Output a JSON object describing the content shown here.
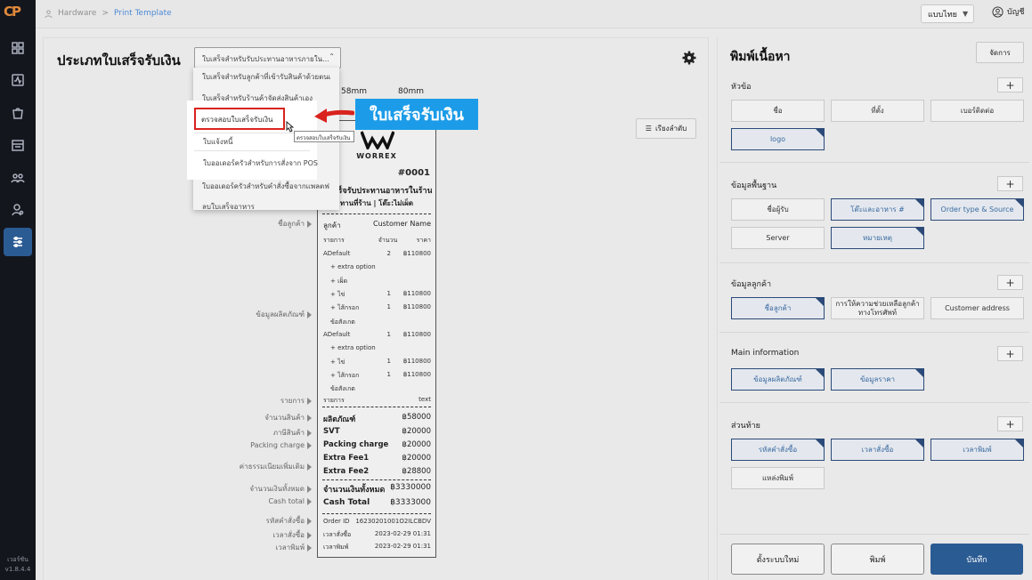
{
  "app": {
    "logo": "CP",
    "version_label": "เวอร์ชัน",
    "version": "v1.8.4.4"
  },
  "breadcrumb": {
    "root": "Hardware",
    "separator": ">",
    "current": "Print Template"
  },
  "topbar": {
    "language": "แบบไทย",
    "account": "บัญชี"
  },
  "center": {
    "title": "ประเภทใบเสร็จรับเงิน",
    "type_select_value": "ใบเสร็จสำหรับรับประทานอาหารภายใน...",
    "sort_button": "เรียงลำดับ",
    "width_options": [
      "58mm",
      "80mm"
    ],
    "dropdown_items": [
      "ใบเสร็จสำหรับลูกค้าที่เข้ารับสินค้าด้วยตนเ",
      "ใบเสร็จสำหรับร้านค้าจัดส่งสินค้าเอง",
      "ตรวจสอบใบเสร็จรับเงิน",
      "ใบแจ้งหนี้",
      "ใบออเดอร์ครัวสำหรับการสั่งจาก POS",
      "ใบออเดอร์ครัวสำหรับคำสั่งซื้อจากแพลตฟ",
      "ลบใบเสร็จอาหาร"
    ],
    "tooltip": "ตรวจสอบใบเสร็จรับเงิน",
    "callout": "ใบเสร็จรับเงิน"
  },
  "side_labels": [
    "ชื่อลูกค้า",
    "ข้อมูลผลิตภัณฑ์",
    "รายการ",
    "จำนวนสินค้า",
    "ภาษีสินค้า",
    "Packing charge",
    "ค่าธรรมเนียมเพิ่มเติม",
    "จำนวนเงินทั้งหมด",
    "Cash total",
    "รหัสคำสั่งซื้อ",
    "เวลาสั่งซื้อ",
    "เวลาพิมพ์"
  ],
  "receipt": {
    "brand": "WORREX",
    "order_no": "#0001",
    "heading": "ใบเสร็จรับประทานอาหารในร้าน",
    "subheading": "ทานที่ร้าน | โต๊ะ:ไม่เผ็ด",
    "customer_label": "ลูกค้า",
    "customer_value": "Customer Name",
    "col_item": "รายการ",
    "col_qty": "จำนวน",
    "col_price": "ราคา",
    "lines": [
      [
        "ADefault",
        "2",
        "฿110800"
      ],
      [
        "+ extra option",
        "",
        ""
      ],
      [
        "+ เผ็ด",
        "",
        ""
      ],
      [
        "+ ไข่",
        "1",
        "฿110800"
      ],
      [
        "+ ไส้กรอก",
        "1",
        "฿110800"
      ],
      [
        "ข้อสังเกต",
        "",
        ""
      ],
      [
        "ADefault",
        "1",
        "฿110800"
      ],
      [
        "+ extra option",
        "",
        ""
      ],
      [
        "+ ไข่",
        "1",
        "฿110800"
      ],
      [
        "+ ไส้กรอก",
        "1",
        "฿110800"
      ],
      [
        "ข้อสังเกต",
        "",
        ""
      ]
    ],
    "items_label": "รายการ",
    "items_value": "text",
    "totals": [
      [
        "ผลิตภัณฑ์",
        "฿58000"
      ],
      [
        "SVT",
        "฿20000"
      ],
      [
        "Packing charge",
        "฿20000"
      ],
      [
        "Extra Fee1",
        "฿20000"
      ],
      [
        "Extra Fee2",
        "฿28800"
      ]
    ],
    "grand_label": "จำนวนเงินทั้งหมด",
    "grand_value": "฿3330000",
    "cash_label": "Cash Total",
    "cash_value": "฿3333000",
    "footer": [
      [
        "Order ID",
        "16230201001O2ILCBDV"
      ],
      [
        "เวลาสั่งซื้อ",
        "2023-02-29 01:31"
      ],
      [
        "เวลาพิมพ์",
        "2023-02-29 01:31"
      ]
    ]
  },
  "right": {
    "title": "พิมพ์เนื้อหา",
    "manage": "จัดการ",
    "sections": {
      "header": {
        "title": "หัวข้อ",
        "chips": [
          "ชื่อ",
          "ที่ตั้ง",
          "เบอร์ติดต่อ",
          "logo"
        ]
      },
      "basic": {
        "title": "ข้อมูลพื้นฐาน",
        "chips": [
          "ชื่อผู้รับ",
          "โต๊ะและอาหาร #",
          "Order type & Source",
          "Server",
          "หมายเหตุ"
        ]
      },
      "customer": {
        "title": "ข้อมูลลูกค้า",
        "chips": [
          "ชื่อลูกค้า",
          "การให้ความช่วยเหลือลูกค้าทางโทรศัพท์",
          "Customer address"
        ]
      },
      "main": {
        "title": "Main information",
        "chips": [
          "ข้อมูลผลิตภัณฑ์",
          "ข้อมูลราคา"
        ]
      },
      "footer": {
        "title": "ส่วนท้าย",
        "chips": [
          "รหัสคำสั่งซื้อ",
          "เวลาสั่งซื้อ",
          "เวลาพิมพ์",
          "แหล่งพิมพ์"
        ]
      }
    },
    "plus": "+",
    "buttons": {
      "reset": "ตั้งระบบใหม่",
      "print": "พิมพ์",
      "save": "บันทึก"
    }
  }
}
